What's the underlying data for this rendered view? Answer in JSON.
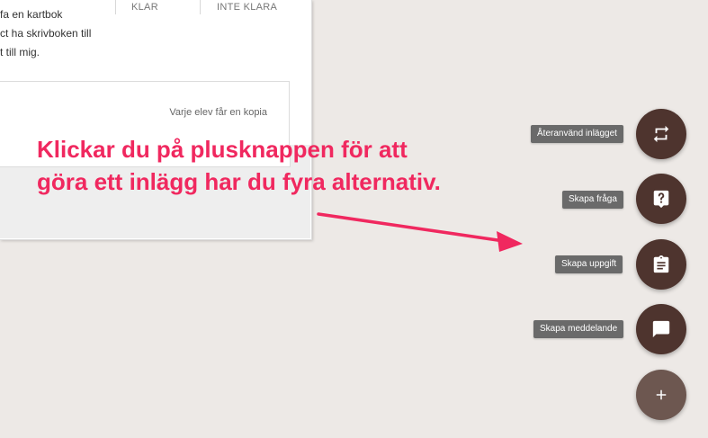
{
  "assignment": {
    "description": "fa en kartbok\nct ha skrivboken till\nt till mig.",
    "col_done": "KLAR",
    "col_not_done": "INTE KLARA",
    "copy_note": "Varje elev får en kopia"
  },
  "caption": "Klickar du på plusknappen för att\ngöra ett inlägg har du fyra alternativ.",
  "fab_menu": {
    "reuse": "Återanvänd inlägget",
    "question": "Skapa fråga",
    "assignment": "Skapa uppgift",
    "announcement": "Skapa meddelande"
  },
  "icons": {
    "reuse": "repeat-icon",
    "question": "question-icon",
    "assignment": "clipboard-icon",
    "announcement": "message-icon",
    "create": "plus-icon"
  },
  "colors": {
    "fab": "#4e342e",
    "fab_main": "#6d5750",
    "caption": "#f0285f",
    "background": "#ede9e6"
  }
}
